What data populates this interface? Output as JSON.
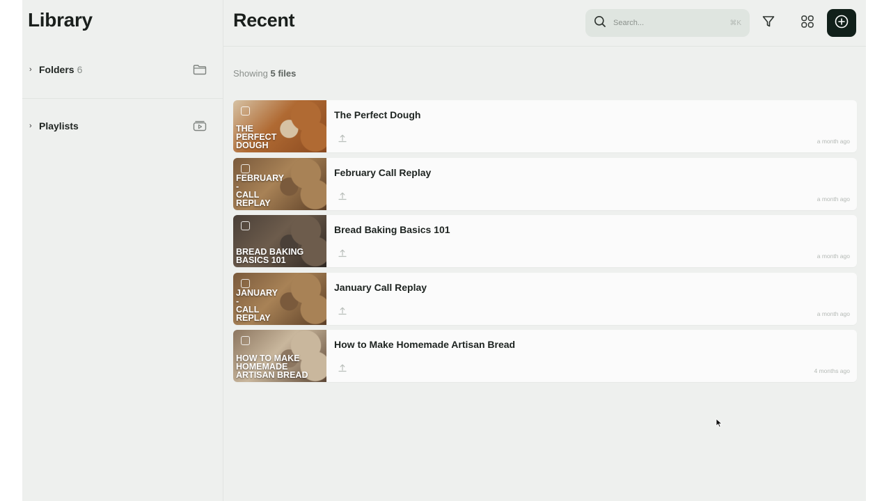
{
  "sidebar": {
    "title": "Library",
    "folders": {
      "label": "Folders",
      "count": "6",
      "icon": "folder-icon"
    },
    "playlists": {
      "label": "Playlists",
      "icon": "playlist-icon"
    }
  },
  "header": {
    "title": "Recent",
    "search_placeholder": "Search...",
    "search_shortcut": "⌘K",
    "filter_icon": "filter-icon",
    "grid_icon": "grid-view-icon",
    "add_icon": "add-icon"
  },
  "summary": {
    "prefix": "Showing",
    "count_text": "5 files"
  },
  "files": [
    {
      "title": "The Perfect Dough",
      "thumb_text": "THE\nPERFECT\nDOUGH",
      "time": "a month ago",
      "thumb_colors": [
        "#d6c2a4",
        "#b06a33",
        "#8a4a20"
      ]
    },
    {
      "title": "February Call Replay",
      "thumb_text": "FEBRUARY\n-\nCALL\nREPLAY",
      "time": "a month ago",
      "thumb_colors": [
        "#7a5a3c",
        "#a88256",
        "#5b3e26"
      ]
    },
    {
      "title": "Bread Baking Basics 101",
      "thumb_text": "BREAD BAKING\nBASICS 101",
      "time": "a month ago",
      "thumb_colors": [
        "#4a4038",
        "#6d5c4c",
        "#2e2722"
      ]
    },
    {
      "title": "January Call Replay",
      "thumb_text": "JANUARY\n-\nCALL\nREPLAY",
      "time": "a month ago",
      "thumb_colors": [
        "#7a5a3c",
        "#a88256",
        "#5b3e26"
      ]
    },
    {
      "title": "How to Make Homemade Artisan Bread",
      "thumb_text": "HOW TO MAKE\nHOMEMADE\nARTISAN BREAD",
      "time": "4 months ago",
      "thumb_colors": [
        "#8c7660",
        "#c9b79d",
        "#5c4634"
      ]
    }
  ],
  "colors": {
    "accent": "#11201a",
    "background": "#eef0ee",
    "row_bg": "#fbfbfb"
  }
}
